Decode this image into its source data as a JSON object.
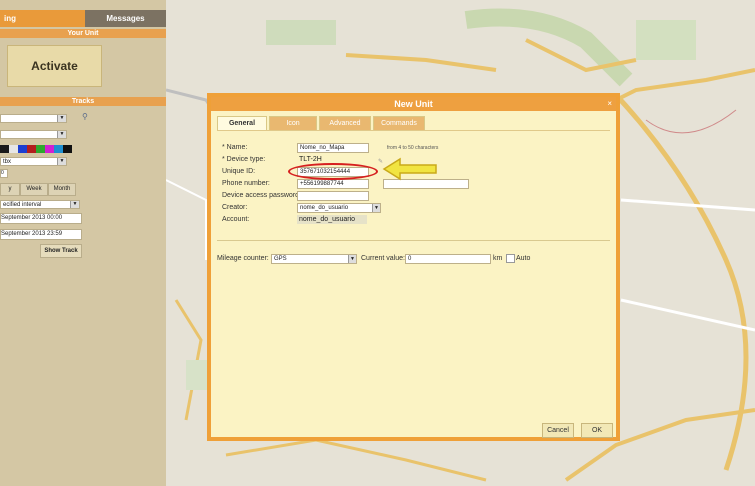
{
  "sidebar": {
    "tab_active": "ing",
    "tab_messages": "Messages",
    "your_unit_label": "Your Unit",
    "activate_label": "Activate",
    "tracks_label": "Tracks",
    "select_4_value": "tbx",
    "number_one": "0",
    "period_day": "y",
    "period_week": "Week",
    "period_month": "Month",
    "interval_select": "ecified interval",
    "date_from": "September 2013 00:00",
    "date_to": "September 2013 23:59",
    "show_track_label": "Show Track",
    "swatch_colors": [
      "#1a1a1a",
      "#e6e6e6",
      "#1d3fd1",
      "#b31e1e",
      "#2ea82e",
      "#d21fd2",
      "#1e8fd1",
      "#111111"
    ]
  },
  "dialog": {
    "title": "New Unit",
    "close": "×",
    "tabs": [
      "General",
      "Icon",
      "Advanced",
      "Commands"
    ],
    "fields": {
      "name_label": "* Name:",
      "name_value": "Nome_no_Mapa",
      "name_hint": "from 4 to 50 characters",
      "device_type_label": "* Device type:",
      "device_type_value": "TLT-2H",
      "unique_id_label": "Unique ID:",
      "unique_id_value": "357671032154444",
      "phone_label": "Phone number:",
      "phone_value": "+556199887744",
      "password_label": "Device access password:",
      "password_value": "",
      "creator_label": "Creator:",
      "creator_value": "nome_do_usuario",
      "account_label": "Account:",
      "account_value": "nome_do_usuario"
    },
    "mileage": {
      "label": "Mileage counter:",
      "value": "GPS",
      "current_label": "Current value:",
      "current_value": "0",
      "unit": "km",
      "auto_label": "Auto"
    },
    "cancel_label": "Cancel",
    "ok_label": "OK"
  },
  "annotation": {
    "ellipse_color": "#d61f1f",
    "arrow_color": "#f0e040"
  }
}
